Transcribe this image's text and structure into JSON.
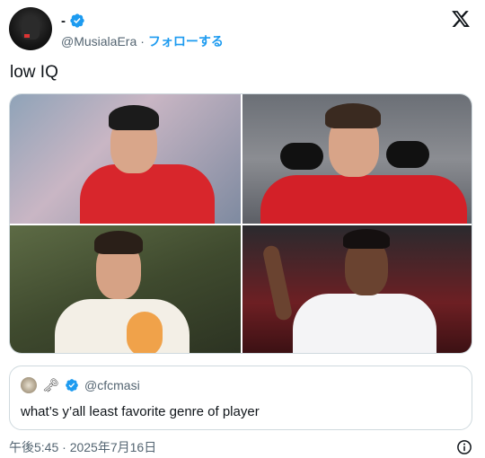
{
  "author": {
    "display_name": "-",
    "handle": "@MusialaEra",
    "separator": "·",
    "follow_label": "フォローする",
    "verified_icon": "verified-badge-icon",
    "accent_color": "#1d9bf0"
  },
  "platform_icon": "x-logo-icon",
  "tweet": {
    "text": "low IQ",
    "photos": [
      {
        "icon": "photo-player-red-kit"
      },
      {
        "icon": "photo-player-red-kit-gloves"
      },
      {
        "icon": "photo-player-white-orange-kit"
      },
      {
        "icon": "photo-player-white-kit"
      }
    ]
  },
  "quoted_tweet": {
    "emoji": "🗝",
    "handle": "@cfcmasi",
    "text": "what’s y’all least favorite genre of player"
  },
  "footer": {
    "timestamp": "午後5:45 · 2025年7月16日",
    "info_icon": "info-icon"
  }
}
